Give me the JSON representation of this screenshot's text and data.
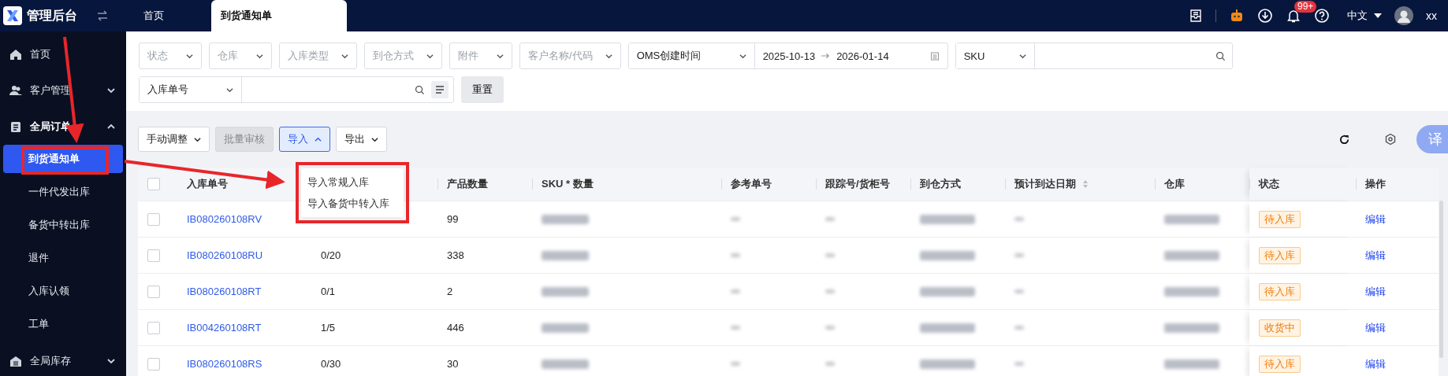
{
  "app": {
    "title": "管理后台"
  },
  "tabs": [
    {
      "label": "首页",
      "selected": false
    },
    {
      "label": "到货通知单",
      "selected": true
    }
  ],
  "header": {
    "language": "中文",
    "notification_count": "99+",
    "user": "xx"
  },
  "sidebar": {
    "items": [
      {
        "label": "首页"
      },
      {
        "label": "客户管理",
        "expanded": false
      },
      {
        "label": "全局订单",
        "expanded": true,
        "children": [
          {
            "label": "到货通知单",
            "selected": true
          },
          {
            "label": "一件代发出库",
            "selected": false
          },
          {
            "label": "备货中转出库",
            "selected": false
          },
          {
            "label": "退件",
            "selected": false
          },
          {
            "label": "入库认领",
            "selected": false
          },
          {
            "label": "工单",
            "selected": false
          }
        ]
      },
      {
        "label": "全局库存",
        "expanded": false
      }
    ]
  },
  "filters": {
    "selects": [
      {
        "placeholder": "状态"
      },
      {
        "placeholder": "仓库"
      },
      {
        "placeholder": "入库类型"
      },
      {
        "placeholder": "到仓方式"
      },
      {
        "placeholder": "附件"
      },
      {
        "placeholder": "客户名称/代码"
      }
    ],
    "date_type": "OMS创建时间",
    "date_from": "2025-10-13",
    "date_to": "2026-01-14",
    "sku_type": "SKU",
    "number_type": "入库单号",
    "reset": "重置"
  },
  "toolbar": {
    "buttons": [
      {
        "label": "手动调整",
        "disabled": false,
        "expanded": false
      },
      {
        "label": "批量审核",
        "disabled": true
      },
      {
        "label": "导入",
        "disabled": false,
        "expanded": true
      },
      {
        "label": "导出",
        "disabled": false,
        "expanded": false
      }
    ],
    "translate": "译"
  },
  "import_menu": [
    "导入常规入库",
    "导入备货中转入库"
  ],
  "table": {
    "all_checked": false,
    "columns": [
      {
        "label": "入库单号"
      },
      {
        "label": "产品数量"
      },
      {
        "label": "SKU * 数量"
      },
      {
        "label": "参考单号"
      },
      {
        "label": "跟踪号/货柜号"
      },
      {
        "label": "到仓方式"
      },
      {
        "label": "预计到达日期",
        "sortable": true
      },
      {
        "label": "仓库"
      },
      {
        "label": "状态"
      },
      {
        "label": "操作"
      }
    ],
    "rows": [
      {
        "checked": false,
        "number": "IB080260108RV",
        "quantity": "99",
        "status": "待入库",
        "action": "编辑"
      },
      {
        "checked": false,
        "number": "IB080260108RU",
        "column_2": "0/20",
        "quantity": "338",
        "status": "待入库",
        "action": "编辑"
      },
      {
        "checked": false,
        "number": "IB080260108RT",
        "column_2": "0/1",
        "quantity": "2",
        "status": "待入库",
        "action": "编辑"
      },
      {
        "checked": false,
        "number": "IB004260108RT",
        "column_2": "1/5",
        "quantity": "446",
        "status": "收货中",
        "action": "编辑"
      },
      {
        "checked": false,
        "number": "IB080260108RS",
        "column_2": "0/30",
        "quantity": "30",
        "status": "待入库",
        "action": "编辑"
      }
    ]
  }
}
